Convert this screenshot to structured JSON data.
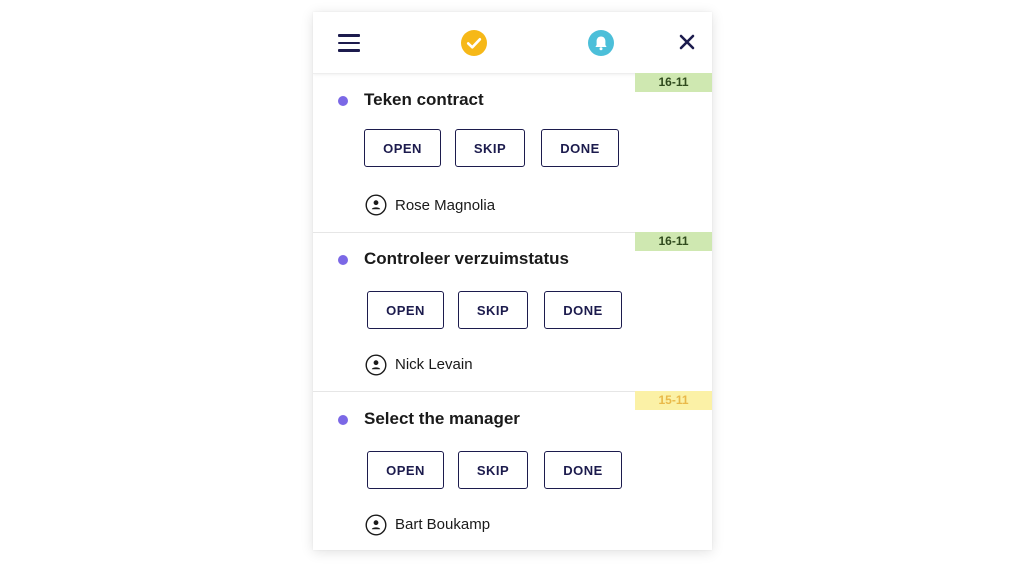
{
  "header": {
    "menu_icon": "hamburger-menu-icon",
    "status_icon": "check-circle-icon",
    "notification_icon": "bell-icon",
    "close_icon": "close-icon",
    "colors": {
      "check": "#f6b818",
      "bell": "#4cbfd9",
      "navy": "#1c1b4d"
    }
  },
  "tasks": [
    {
      "date": "16-11",
      "date_status": "green",
      "title": "Teken contract",
      "buttons": {
        "open": "OPEN",
        "skip": "SKIP",
        "done": "DONE"
      },
      "assignee": "Rose Magnolia"
    },
    {
      "date": "16-11",
      "date_status": "green",
      "title": "Controleer verzuimstatus",
      "buttons": {
        "open": "OPEN",
        "skip": "SKIP",
        "done": "DONE"
      },
      "assignee": "Nick Levain"
    },
    {
      "date": "15-11",
      "date_status": "yellow",
      "title": "Select the manager",
      "buttons": {
        "open": "OPEN",
        "skip": "SKIP",
        "done": "DONE"
      },
      "assignee": "Bart Boukamp"
    }
  ],
  "colors": {
    "bullet": "#7b68e6",
    "date_green_bg": "#cfe8b1",
    "date_yellow_bg": "#fbf1a6"
  }
}
